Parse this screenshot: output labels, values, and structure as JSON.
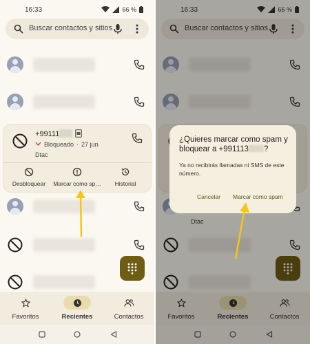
{
  "status": {
    "time": "16:33",
    "battery": "66 %"
  },
  "search": {
    "placeholder": "Buscar contactos y sitios"
  },
  "expanded_entry": {
    "number": "+9911139",
    "status": "Bloqueado",
    "date": "27 jun",
    "separator": "·",
    "carrier": "Dtac",
    "actions": [
      {
        "label": "Desbloquear",
        "icon": "block-circle-icon"
      },
      {
        "label": "Marcar como sp…",
        "icon": "report-icon"
      },
      {
        "label": "Historial",
        "icon": "history-icon"
      }
    ]
  },
  "bottom_nav": [
    {
      "label": "Favoritos",
      "icon": "star-icon"
    },
    {
      "label": "Recientes",
      "icon": "clock-icon",
      "active": true
    },
    {
      "label": "Contactos",
      "icon": "people-icon"
    }
  ],
  "dialog": {
    "title_prefix": "¿Quieres marcar como spam y bloquear a +991113",
    "title_suffix": "?",
    "body": "Ya no recibirás llamadas ni SMS de este número.",
    "cancel": "Cancelar",
    "confirm": "Marcar como spam"
  },
  "colors": {
    "background": "#fbf8f1",
    "fab": "#6f5d16",
    "active_pill": "#e8dcae",
    "arrow": "#f5c518",
    "avatar": "#98a0b7"
  }
}
